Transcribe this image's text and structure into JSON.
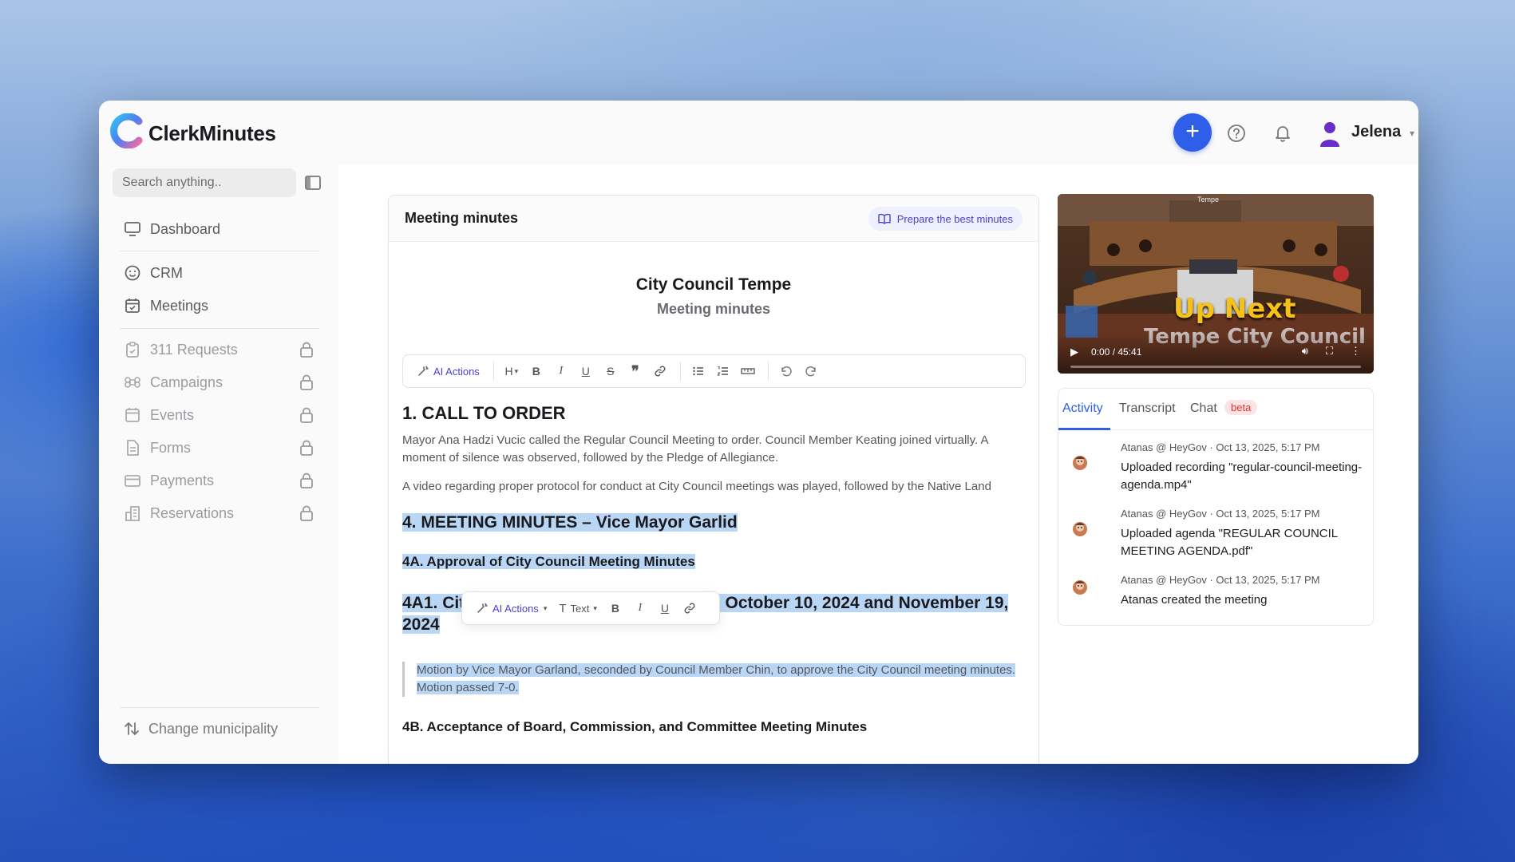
{
  "app": {
    "brand": "ClerkMinutes",
    "user_name": "Jelena"
  },
  "sidebar": {
    "search_placeholder": "Search anything..",
    "items": [
      {
        "label": "Dashboard"
      },
      {
        "label": "CRM"
      },
      {
        "label": "Meetings"
      },
      {
        "label": "311 Requests"
      },
      {
        "label": "Campaigns"
      },
      {
        "label": "Events"
      },
      {
        "label": "Forms"
      },
      {
        "label": "Payments"
      },
      {
        "label": "Reservations"
      }
    ],
    "change_municipality": "Change municipality"
  },
  "editor": {
    "card_title": "Meeting minutes",
    "prepare_button": "Prepare the best minutes",
    "doc_title": "City Council Tempe",
    "doc_subtitle": "Meeting minutes",
    "toolbar": {
      "ai_actions": "AI Actions",
      "heading": "H",
      "text_style": "Text"
    },
    "h_call_to_order": "1. CALL TO ORDER",
    "para1": "Mayor Ana Hadzi Vucic called the Regular Council Meeting to order. Council Member Keating joined virtually. A moment of silence was observed, followed by the Pledge of Allegiance.",
    "para2": "A video regarding proper protocol for conduct at City Council meetings was played, followed by the Native Land",
    "h4": "4. MEETING MINUTES – Vice Mayor Garlid",
    "h4a": "4A. Approval of City Council Meeting Minutes",
    "h4a1": "4A1. City Council Work Study Session – October 10, 2024 and November 19, 2024",
    "quote": "Motion by Vice Mayor Garland, seconded by Council Member Chin, to approve the City Council meeting minutes. Motion passed 7-0.",
    "h4b": "4B. Acceptance of Board, Commission, and Committee Meeting Minutes"
  },
  "video": {
    "overlay_title": "Up Next",
    "overlay_subtitle": "Tempe City Council",
    "time": "0:00 / 45:41",
    "banner": "Tempe"
  },
  "activity": {
    "tabs": [
      "Activity",
      "Transcript",
      "Chat"
    ],
    "badge": "beta",
    "items": [
      {
        "meta": "Atanas @ HeyGov · Oct 13, 2025, 5:17 PM",
        "text": "Uploaded recording \"regular-council-meeting-agenda.mp4\""
      },
      {
        "meta": "Atanas @ HeyGov · Oct 13, 2025, 5:17 PM",
        "text": "Uploaded agenda \"REGULAR COUNCIL MEETING AGENDA.pdf\""
      },
      {
        "meta": "Atanas @ HeyGov · Oct 13, 2025, 5:17 PM",
        "text": "Atanas created the meeting"
      }
    ]
  },
  "colors": {
    "accent": "#2f5fe8",
    "ai_purple": "#4a3fd0",
    "highlight": "#b9d7f5",
    "beta_bg": "#fde3e3"
  }
}
